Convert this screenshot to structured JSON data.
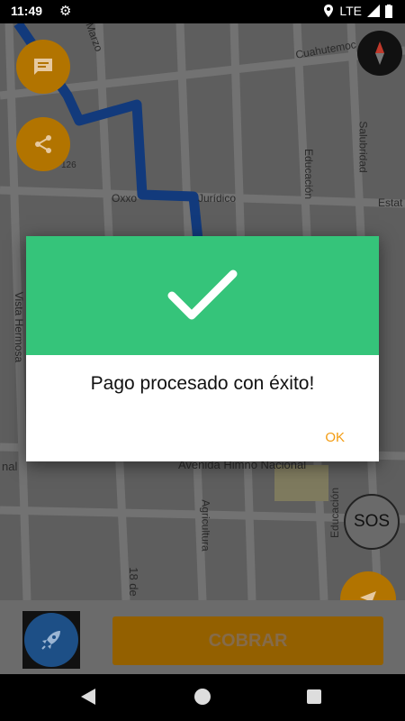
{
  "status_bar": {
    "time": "11:49",
    "network": "LTE"
  },
  "map": {
    "labels": {
      "marzo": "Marzo",
      "cuahutemoc": "Cuahutemoc",
      "educacion_top": "Educación",
      "salubridad": "Salubridad",
      "oxxo": "Oxxo",
      "juridico": "Jurídico",
      "estat": "Estat",
      "vista_hermosa": "Vista Hermosa",
      "avenida": "Avenida Himno Nacional",
      "nal": "nal",
      "agricultura": "Agricultura",
      "educacion_bottom": "Educación",
      "dieciocho": "18 de",
      "num126": "126"
    }
  },
  "buttons": {
    "sos": "SOS",
    "cobrar": "COBRAR"
  },
  "dialog": {
    "message": "Pago procesado con éxito!",
    "ok": "OK"
  }
}
